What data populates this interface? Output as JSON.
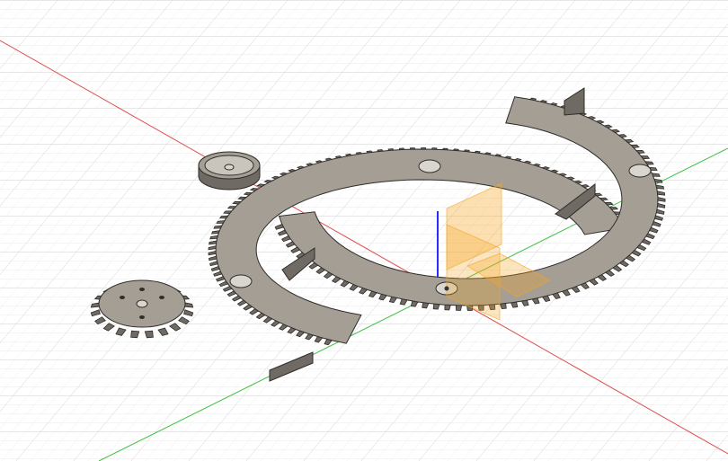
{
  "viewport": {
    "background": "#ffffff",
    "grid_color": "#d2d2d2",
    "grid_minor_color": "#e6e6e6",
    "axis_x_color": "#e05050",
    "axis_y_color": "#3fbf3f",
    "axis_z_color": "#2a2aff"
  },
  "model": {
    "body_color": "#a49e95",
    "side_color": "#6f6a63",
    "edge_color": "#2f2c29",
    "hole_color": "#d9d6d0",
    "origin_plane_color": "#f5a623",
    "parts": [
      "large-ring-gear-segment",
      "small-ring-gear-segment",
      "small-spur-gear",
      "bearing-cap"
    ]
  }
}
